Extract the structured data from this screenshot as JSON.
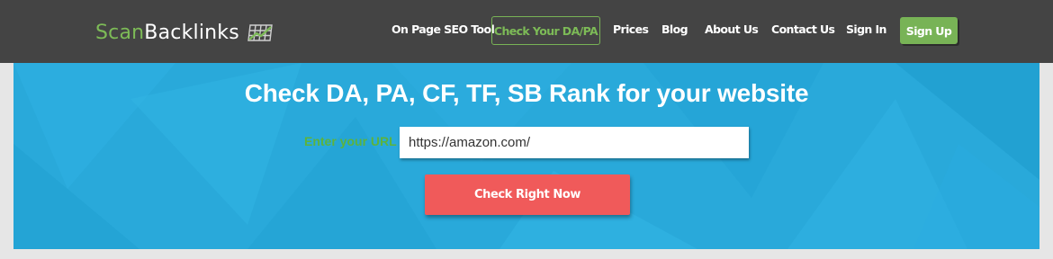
{
  "brand": {
    "name_part1": "Scan",
    "name_part2": "Backlinks",
    "colors": {
      "green": "#7dbb57",
      "white": "#ffffff"
    }
  },
  "nav": {
    "items": [
      {
        "label": "On Page SEO Tool"
      },
      {
        "label": "Check Your DA/PA"
      },
      {
        "label": "Prices"
      },
      {
        "label": "Blog"
      },
      {
        "label": "About Us"
      },
      {
        "label": "Contact Us"
      },
      {
        "label": "Sign In"
      },
      {
        "label": "Sign Up"
      }
    ],
    "active_item": "Check Your DA/PA",
    "colors": {
      "bar": "#444444",
      "accent": "#78b356"
    }
  },
  "hero": {
    "title": "Check DA, PA, CF, TF, SB Rank for your website",
    "url_label": "Enter your URL",
    "url_value": "https://amazon.com/",
    "button_label": "Check Right Now",
    "colors": {
      "background": "#29a9da",
      "button": "#f05a5a",
      "label": "#5cb33d"
    }
  }
}
